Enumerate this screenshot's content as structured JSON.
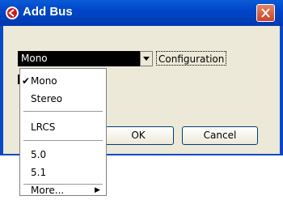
{
  "window": {
    "title": "Add Bus",
    "close_icon": "close-icon"
  },
  "configuration": {
    "selected": "Mono",
    "button_label": "Configuration"
  },
  "dropdown": {
    "items": [
      {
        "label": "Mono",
        "checked": true
      },
      {
        "label": "Stereo"
      },
      {
        "label": "LRCS"
      },
      {
        "label": "5.0"
      },
      {
        "label": "5.1"
      },
      {
        "label": "More...",
        "has_submenu": true
      }
    ]
  },
  "buttons": {
    "ok": "OK",
    "cancel": "Cancel"
  },
  "colors": {
    "titlebar": "#0046c8",
    "close": "#d8552f",
    "selection": "#000000"
  }
}
